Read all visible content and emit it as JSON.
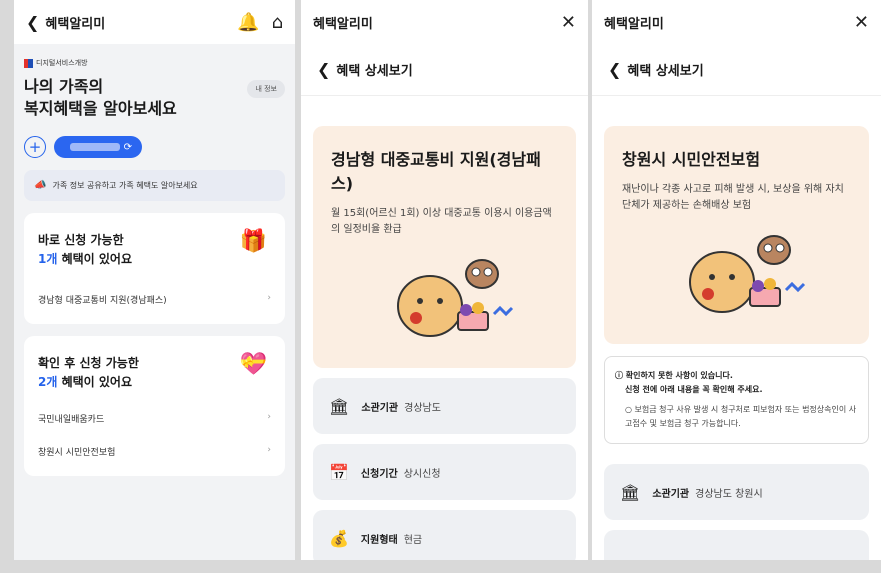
{
  "p1": {
    "title": "혜택알리미",
    "logo_text": "디지털서비스개방",
    "hero": [
      "나의 가족의",
      "복지혜택을 알아보세요"
    ],
    "myinfo": "내 정보",
    "share_text": "가족 정보 공유하고 가족 혜택도 알아보세요",
    "card1": {
      "title": "바로 신청 가능한",
      "count": "1개",
      "suffix": " 혜택이 있어요",
      "items": [
        "경남형 대중교통비 지원(경남패스)"
      ]
    },
    "card2": {
      "title": "확인 후 신청 가능한",
      "count": "2개",
      "suffix": " 혜택이 있어요",
      "items": [
        "국민내일배움카드",
        "창원시 시민안전보험"
      ]
    }
  },
  "p2": {
    "title": "혜택알리미",
    "sub": "혜택 상세보기",
    "heading": "경남형 대중교통비 지원(경남패스)",
    "desc": "월 15회(어르신 1회) 이상 대중교통 이용시 이용금액의 일정비율 환급",
    "rows": [
      {
        "label": "소관기관",
        "value": "경상남도"
      },
      {
        "label": "신청기간",
        "value": "상시신청"
      },
      {
        "label": "지원형태",
        "value": "현금"
      }
    ]
  },
  "p3": {
    "title": "혜택알리미",
    "sub": "혜택 상세보기",
    "heading": "창원시 시민안전보험",
    "desc": "재난이나 각종 사고로 피해 발생 시, 보상을 위해 자치단체가 제공하는 손해배상 보험",
    "warn_title": "확인하지 못한 사항이 있습니다.",
    "warn_title2": "신청 전에 아래 내용을 꼭 확인해 주세요.",
    "warn_body": "○ 보험금 청구 사유 발생 시 청구처로 피보험자 또는 법정상속인이 사고접수 및 보험금 청구 가능합니다.",
    "rows": [
      {
        "label": "소관기관",
        "value": "경상남도 창원시"
      }
    ]
  }
}
